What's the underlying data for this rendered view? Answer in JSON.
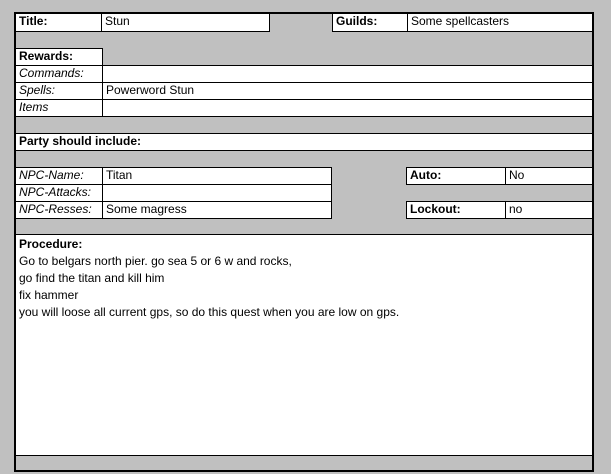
{
  "title": {
    "label": "Title:",
    "value": "Stun"
  },
  "guilds": {
    "label": "Guilds:",
    "value": "Some spellcasters"
  },
  "rewards": {
    "heading": "Rewards:",
    "rows": [
      {
        "label": "Commands:",
        "value": ""
      },
      {
        "label": "Spells:",
        "value": "Powerword Stun"
      },
      {
        "label": "Items",
        "value": ""
      }
    ]
  },
  "party": {
    "heading": "Party should include:"
  },
  "npc": {
    "rows": [
      {
        "label": "NPC-Name:",
        "value": "Titan"
      },
      {
        "label": "NPC-Attacks:",
        "value": ""
      },
      {
        "label": "NPC-Resses:",
        "value": "Some magress"
      }
    ]
  },
  "auto": {
    "label": "Auto:",
    "value": "No"
  },
  "lockout": {
    "label": "Lockout:",
    "value": "no"
  },
  "procedure": {
    "heading": "Procedure:",
    "lines": [
      "Go to belgars north pier. go sea 5 or 6 w and rocks,",
      "go find the titan and kill him",
      "fix hammer",
      "you will loose all current gps, so do this quest when you are low on gps."
    ]
  }
}
